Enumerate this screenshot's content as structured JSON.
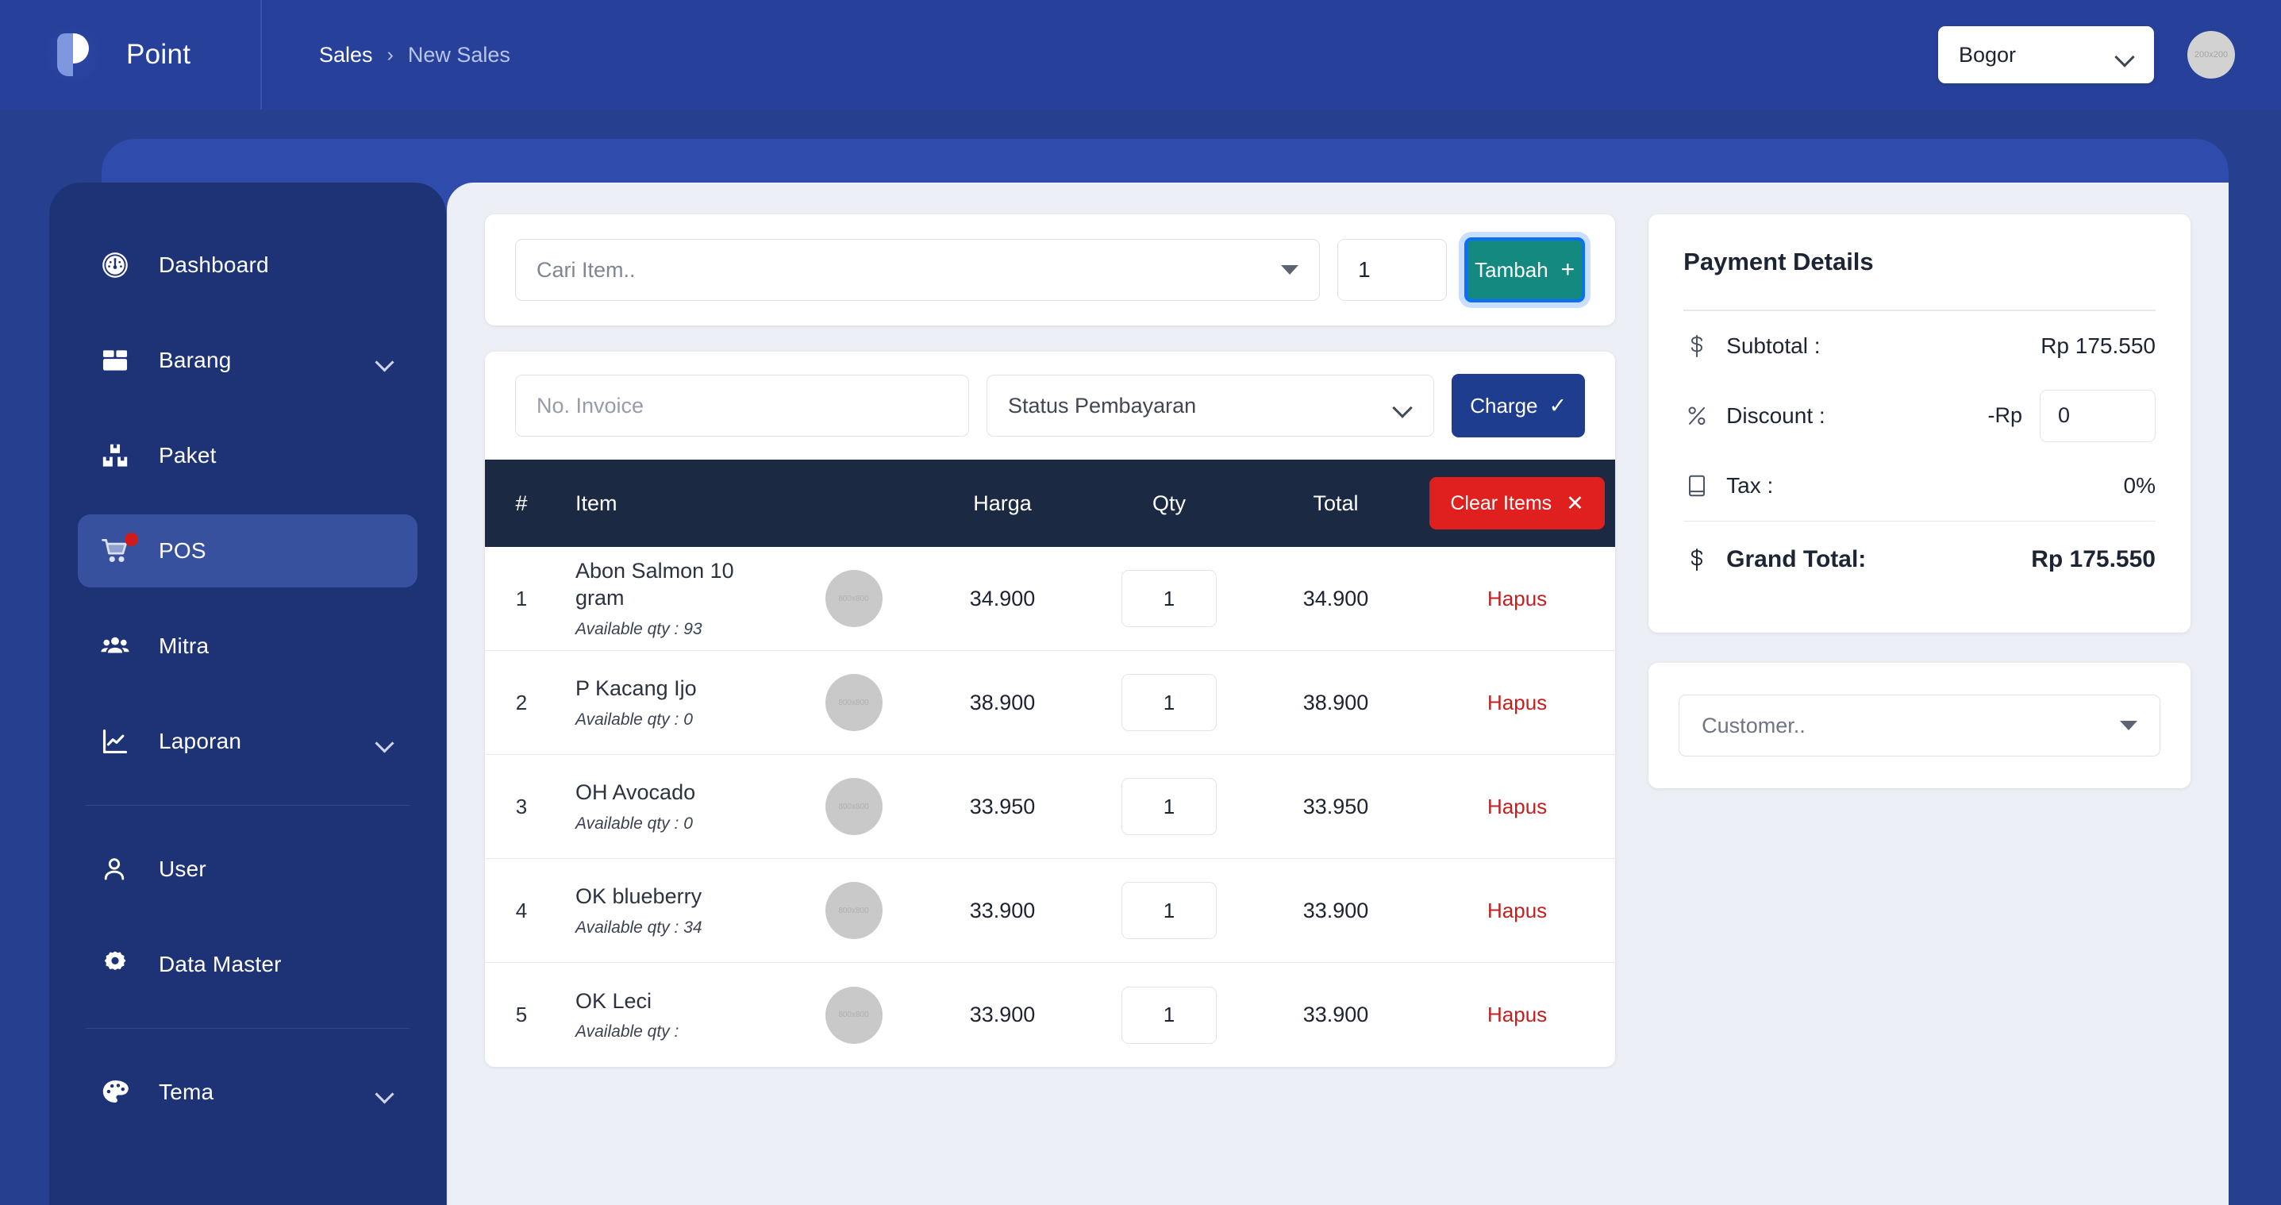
{
  "header": {
    "brand_name": "Point",
    "breadcrumb": {
      "parent": "Sales",
      "separator": "›",
      "current": "New Sales"
    },
    "branch": {
      "value": "Bogor",
      "icon": "chevron-down-icon"
    },
    "avatar_text": "200x200"
  },
  "sidebar": {
    "items": [
      {
        "label": "Dashboard",
        "icon": "gauge-icon",
        "has_chevron": false,
        "active": false,
        "badge": false
      },
      {
        "label": "Barang",
        "icon": "box-icon",
        "has_chevron": true,
        "active": false,
        "badge": false
      },
      {
        "label": "Paket",
        "icon": "boxes-icon",
        "has_chevron": false,
        "active": false,
        "badge": false
      },
      {
        "label": "POS",
        "icon": "shopping-cart-icon",
        "has_chevron": false,
        "active": true,
        "badge": true
      },
      {
        "label": "Mitra",
        "icon": "people-icon",
        "has_chevron": false,
        "active": false,
        "badge": false
      },
      {
        "label": "Laporan",
        "icon": "chart-line-icon",
        "has_chevron": true,
        "active": false,
        "badge": false
      },
      {
        "label": "User",
        "icon": "person-icon",
        "has_chevron": false,
        "active": false,
        "badge": false
      },
      {
        "label": "Data Master",
        "icon": "gear-icon",
        "has_chevron": false,
        "active": false,
        "badge": false
      },
      {
        "label": "Tema",
        "icon": "palette-icon",
        "has_chevron": true,
        "active": false,
        "badge": false
      }
    ]
  },
  "search_bar": {
    "item_select_placeholder": "Cari Item..",
    "qty_value": "1",
    "add_button_label": "Tambah",
    "add_button_glyph": "+"
  },
  "invoice_bar": {
    "invoice_placeholder": "No. Invoice",
    "invoice_value": "",
    "status_placeholder": "Status Pembayaran",
    "charge_button_label": "Charge",
    "charge_button_glyph": "✓"
  },
  "table": {
    "headers": {
      "num": "#",
      "item": "Item",
      "harga": "Harga",
      "qty": "Qty",
      "total": "Total"
    },
    "clear_button_label": "Clear Items",
    "clear_button_glyph": "✕",
    "thumb_text": "800x800",
    "action_label": "Hapus",
    "rows": [
      {
        "num": "1",
        "name": "Abon Salmon 10 gram",
        "available": "Available qty : 93",
        "harga": "34.900",
        "qty": "1",
        "total": "34.900",
        "action": "Hapus"
      },
      {
        "num": "2",
        "name": "P Kacang Ijo",
        "available": "Available qty : 0",
        "harga": "38.900",
        "qty": "1",
        "total": "38.900",
        "action": "Hapus"
      },
      {
        "num": "3",
        "name": "OH Avocado",
        "available": "Available qty : 0",
        "harga": "33.950",
        "qty": "1",
        "total": "33.950",
        "action": "Hapus"
      },
      {
        "num": "4",
        "name": "OK blueberry",
        "available": "Available qty : 34",
        "harga": "33.900",
        "qty": "1",
        "total": "33.900",
        "action": "Hapus"
      },
      {
        "num": "5",
        "name": "OK Leci",
        "available": "Available qty :",
        "harga": "33.900",
        "qty": "1",
        "total": "33.900",
        "action": "Hapus"
      }
    ]
  },
  "payment": {
    "title": "Payment Details",
    "subtotal_label": "Subtotal :",
    "subtotal_value": "Rp 175.550",
    "subtotal_icon": "dollar-icon",
    "discount_label": "Discount :",
    "discount_prefix": "-Rp",
    "discount_value": "0",
    "discount_icon": "percent-icon",
    "tax_label": "Tax :",
    "tax_value": "0%",
    "tax_icon": "receipt-icon",
    "grand_total_label": "Grand Total:",
    "grand_total_value": "Rp 175.550",
    "grand_total_icon": "dollar-icon"
  },
  "customer": {
    "placeholder": "Customer.."
  },
  "colors": {
    "brand_blue": "#27409a",
    "sidebar_navy": "#1e3276",
    "accent_teal": "#13897f",
    "charge_blue": "#1e3d8f",
    "danger_red": "#e01f1f",
    "table_header": "#1c2942",
    "content_bg": "#eceff5"
  }
}
